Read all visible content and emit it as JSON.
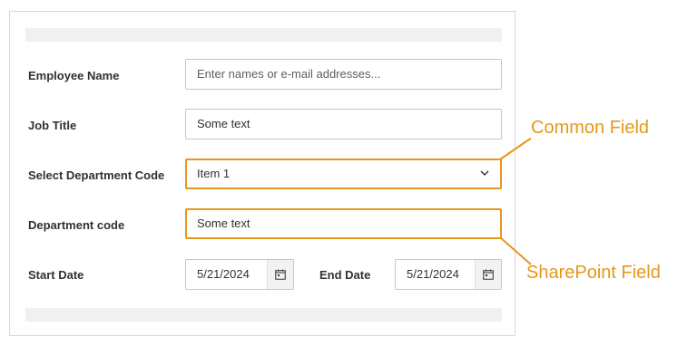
{
  "form": {
    "employee_name": {
      "label": "Employee Name",
      "placeholder": "Enter names or e-mail addresses..."
    },
    "job_title": {
      "label": "Job Title",
      "value": "Some text"
    },
    "department_select": {
      "label": "Select Department Code",
      "value": "Item 1"
    },
    "department_code": {
      "label": "Department code",
      "value": "Some text"
    },
    "start_date": {
      "label": "Start Date",
      "value": "5/21/2024"
    },
    "end_date": {
      "label": "End Date",
      "value": "5/21/2024"
    }
  },
  "callouts": {
    "common": "Common Field",
    "sharepoint": "SharePoint Field"
  },
  "colors": {
    "highlight": "#e69819"
  },
  "icons": [
    "chevron-down-icon",
    "calendar-icon"
  ]
}
